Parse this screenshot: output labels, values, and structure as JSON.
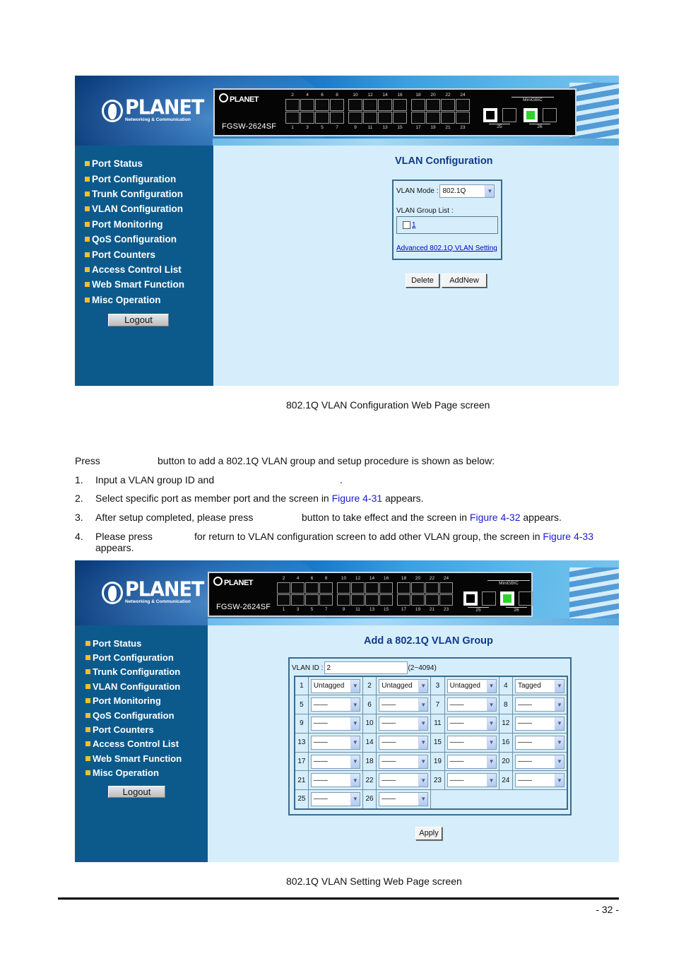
{
  "figure1": {
    "logo": {
      "name": "PLANET",
      "tagline": "Networking & Communication"
    },
    "device": {
      "logo": "PLANET",
      "model": "FGSW-2624SF",
      "top_port_numbers": [
        "2",
        "4",
        "6",
        "8",
        "10",
        "12",
        "14",
        "16",
        "18",
        "20",
        "22",
        "24"
      ],
      "bottom_port_numbers": [
        "1",
        "3",
        "5",
        "7",
        "9",
        "11",
        "13",
        "15",
        "17",
        "19",
        "21",
        "23"
      ],
      "mgbic_label": "MiniGBIC",
      "uplink_labels": [
        "25",
        "26"
      ]
    },
    "sidebar": {
      "items": [
        "Port Status",
        "Port Configuration",
        "Trunk Configuration",
        "VLAN Configuration",
        "Port Monitoring",
        "QoS Configuration",
        "Port Counters",
        "Access Control List",
        "Web Smart Function",
        "Misc Operation"
      ],
      "logout": "Logout"
    },
    "title": "VLAN Configuration",
    "vlan_mode_label": "VLAN Mode :",
    "vlan_mode_value": "802.1Q",
    "group_list_label": "VLAN Group List :",
    "group_items": [
      "1"
    ],
    "advanced_link": "Advanced 802.1Q VLAN Setting",
    "delete_button": "Delete",
    "addnew_button": "AddNew"
  },
  "caption1": "802.1Q VLAN Configuration Web Page screen",
  "intro": {
    "press": "Press",
    "rest": "button to add a 802.1Q VLAN group and setup procedure is shown as below:"
  },
  "steps": [
    {
      "num": "1.",
      "parts": [
        {
          "t": "Input a VLAN group ID and"
        },
        {
          "t": "."
        }
      ]
    },
    {
      "num": "2.",
      "before": "Select specific port as member port and the screen in ",
      "link": "Figure 4-31",
      "after": " appears."
    },
    {
      "num": "3.",
      "before": "After setup completed, please press",
      "middle": "button to take effect and the screen in ",
      "link": "Figure 4-32",
      "after": " appears."
    },
    {
      "num": "4.",
      "before": "Please press",
      "middle": "for return to VLAN configuration screen to add other VLAN group, the screen in ",
      "link": "Figure 4-33",
      "line2": "appears."
    }
  ],
  "figure2": {
    "title": "Add a 802.1Q VLAN Group",
    "vlan_id_label": "VLAN ID :",
    "vlan_id_value": "2",
    "vlan_id_range": "(2~4094)",
    "ports": [
      {
        "port": "1",
        "value": "Untagged"
      },
      {
        "port": "2",
        "value": "Untagged"
      },
      {
        "port": "3",
        "value": "Untagged"
      },
      {
        "port": "4",
        "value": "Tagged"
      },
      {
        "port": "5",
        "value": "——"
      },
      {
        "port": "6",
        "value": "——"
      },
      {
        "port": "7",
        "value": "——"
      },
      {
        "port": "8",
        "value": "——"
      },
      {
        "port": "9",
        "value": "——"
      },
      {
        "port": "10",
        "value": "——"
      },
      {
        "port": "11",
        "value": "——"
      },
      {
        "port": "12",
        "value": "——"
      },
      {
        "port": "13",
        "value": "——"
      },
      {
        "port": "14",
        "value": "——"
      },
      {
        "port": "15",
        "value": "——"
      },
      {
        "port": "16",
        "value": "——"
      },
      {
        "port": "17",
        "value": "——"
      },
      {
        "port": "18",
        "value": "——"
      },
      {
        "port": "19",
        "value": "——"
      },
      {
        "port": "20",
        "value": "——"
      },
      {
        "port": "21",
        "value": "——"
      },
      {
        "port": "22",
        "value": "——"
      },
      {
        "port": "23",
        "value": "——"
      },
      {
        "port": "24",
        "value": "——"
      },
      {
        "port": "25",
        "value": "——"
      },
      {
        "port": "26",
        "value": "——"
      }
    ],
    "apply_button": "Apply"
  },
  "caption2": "802.1Q VLAN Setting Web Page screen",
  "page_number": "- 32 -",
  "colors": {
    "sidebar_bg": "#0c5a8c",
    "content_bg": "#d6eefb",
    "title_color": "#103a8c",
    "bullet": "#f2c02a",
    "link_blue": "#1a1ad6",
    "mgbic_active": "#2ad62a"
  }
}
